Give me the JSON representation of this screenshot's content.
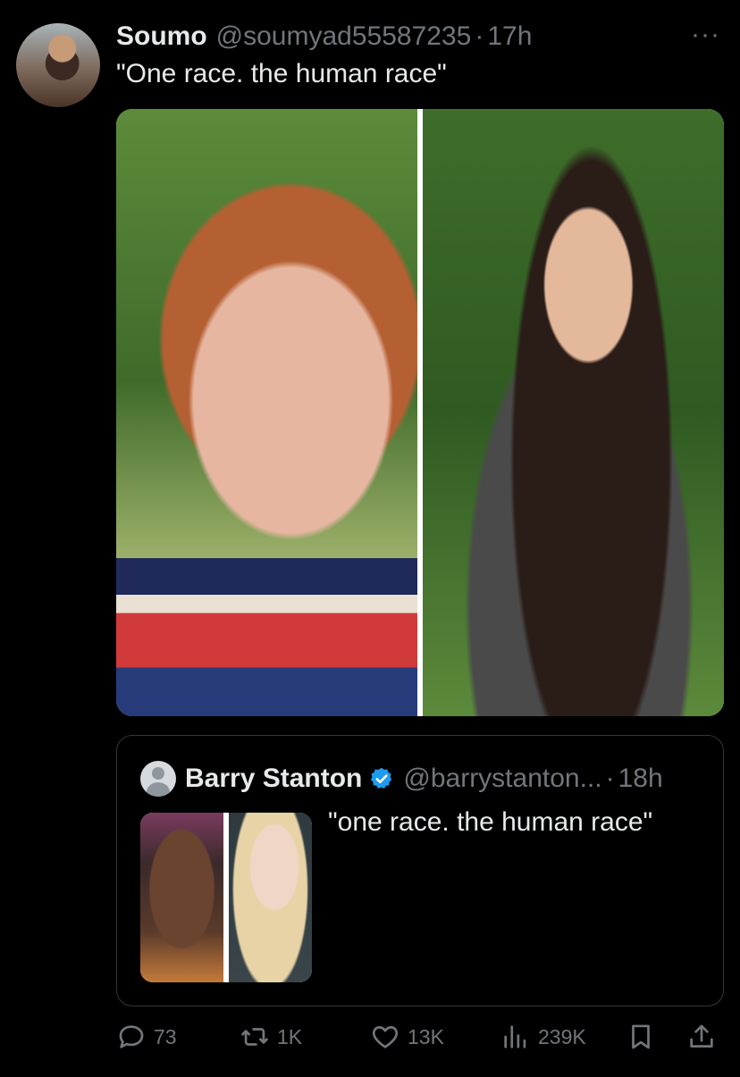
{
  "tweet": {
    "author_name": "Soumo",
    "author_handle": "@soumyad55587235",
    "separator": "·",
    "time": "17h",
    "more_label": "···",
    "text": "\"One race. the human race\""
  },
  "quoted_tweet": {
    "author_name": "Barry Stanton",
    "author_handle": "@barrystanton...",
    "separator": "·",
    "time": "18h",
    "text": "\"one race. the human race\""
  },
  "actions": {
    "replies": "73",
    "reposts": "1K",
    "likes": "13K",
    "views": "239K"
  },
  "colors": {
    "background": "#000000",
    "text_primary": "#e7e9ea",
    "text_secondary": "#71767b",
    "verified_badge": "#1d9bf0",
    "border": "#333639"
  },
  "icons": {
    "reply": "speech-bubble-icon",
    "repost": "repost-arrows-icon",
    "like": "heart-icon",
    "views": "bar-chart-icon",
    "bookmark": "bookmark-icon",
    "share": "share-upload-icon",
    "verified": "verified-check-icon",
    "more": "ellipsis-icon"
  }
}
